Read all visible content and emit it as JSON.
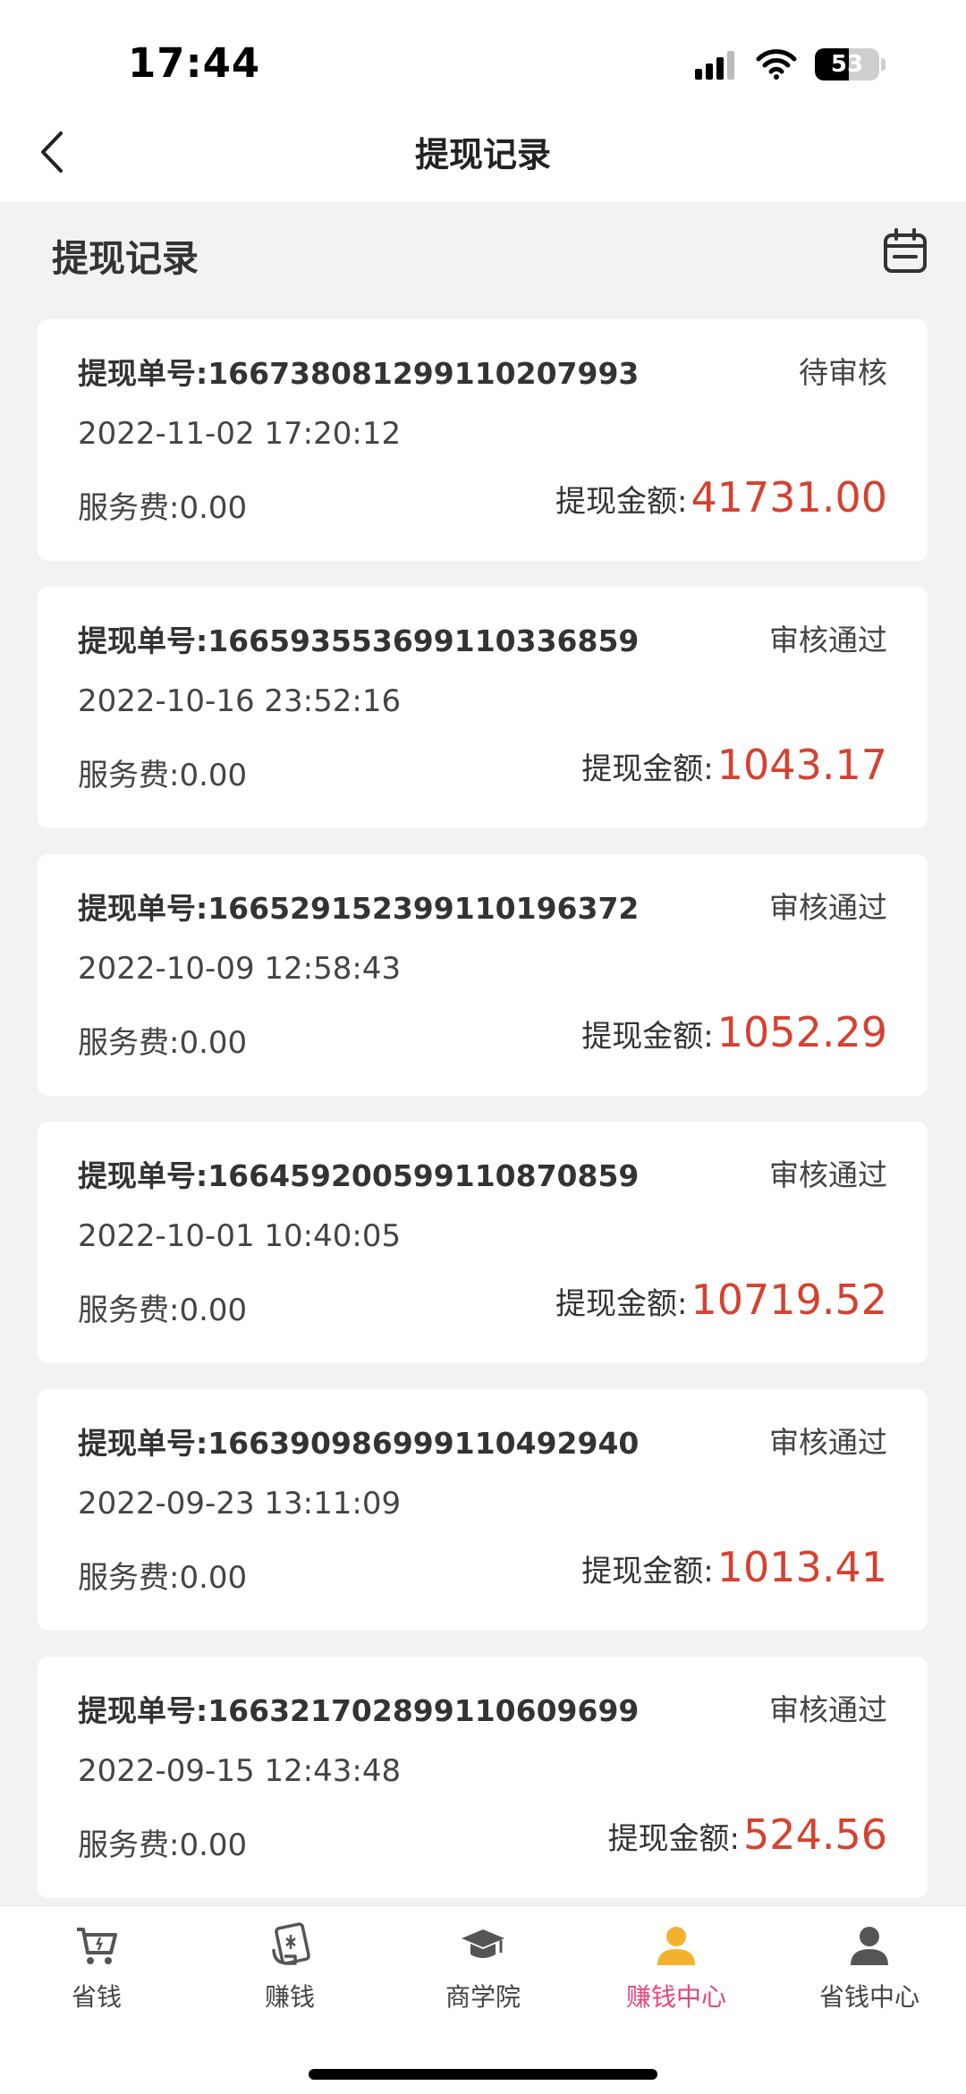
{
  "status_bar": {
    "time": "17:44",
    "battery_level": "53",
    "battery_fraction": 0.53
  },
  "nav": {
    "title": "提现记录"
  },
  "section": {
    "title": "提现记录"
  },
  "records": [
    {
      "order_no": "提现单号:16673808129911020 7993",
      "status": "待审核",
      "time": "2022-11-02 17:20:12",
      "fee": "服务费:0.00",
      "amount_label": "提现金额:",
      "amount": "41731.00"
    },
    {
      "order_no": "提现单号:16659355369911033 6859",
      "status": "审核通过",
      "time": "2022-10-16 23:52:16",
      "fee": "服务费:0.00",
      "amount_label": "提现金额:",
      "amount": "1043.17"
    },
    {
      "order_no": "提现单号:16652915239911019 6372",
      "status": "审核通过",
      "time": "2022-10-09 12:58:43",
      "fee": "服务费:0.00",
      "amount_label": "提现金额:",
      "amount": "1052.29"
    },
    {
      "order_no": "提现单号:16645920059911087 0859",
      "status": "审核通过",
      "time": "2022-10-01 10:40:05",
      "fee": "服务费:0.00",
      "amount_label": "提现金额:",
      "amount": "10719.52"
    },
    {
      "order_no": "提现单号:16639098699911049 2940",
      "status": "审核通过",
      "time": "2022-09-23 13:11:09",
      "fee": "服务费:0.00",
      "amount_label": "提现金额:",
      "amount": "1013.41"
    },
    {
      "order_no": "提现单号:16632170289911060 9699",
      "status": "审核通过",
      "time": "2022-09-15 12:43:48",
      "fee": "服务费:0.00",
      "amount_label": "提现金额:",
      "amount": "524.56"
    }
  ],
  "tabs": [
    {
      "label": "省钱",
      "icon": "cart-icon"
    },
    {
      "label": "赚钱",
      "icon": "money-card-icon"
    },
    {
      "label": "商学院",
      "icon": "graduation-cap-icon"
    },
    {
      "label": "赚钱中心",
      "icon": "user-icon",
      "active": true
    },
    {
      "label": "省钱中心",
      "icon": "user-icon"
    }
  ],
  "colors": {
    "amount": "#d6412f",
    "active_tab": "#e8457a",
    "active_tab_icon": "#f2b22f"
  }
}
